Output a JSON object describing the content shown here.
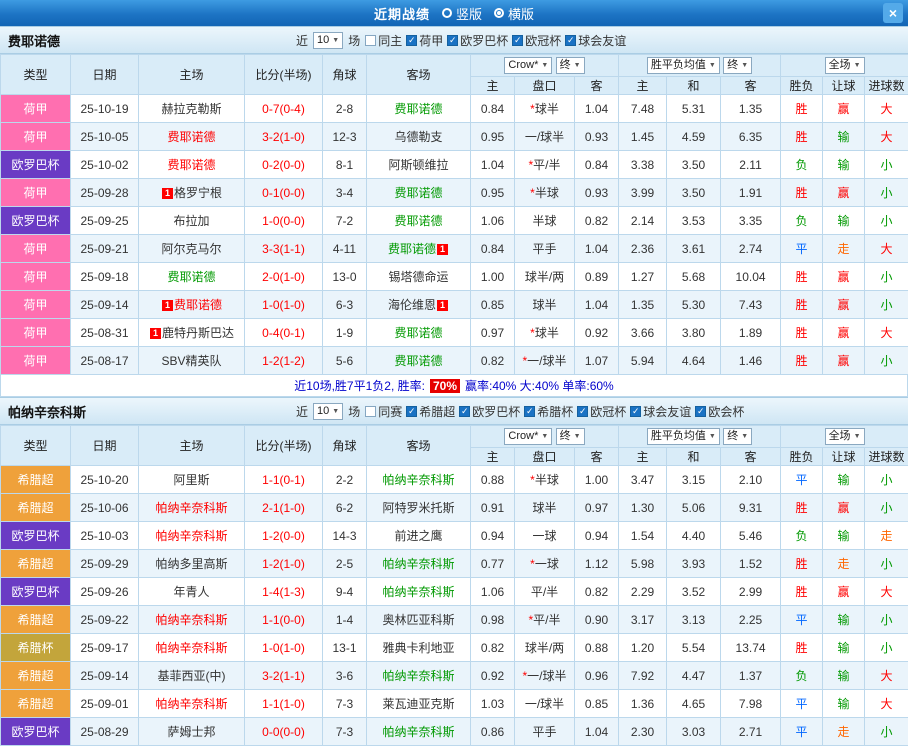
{
  "topbar": {
    "title": "近期战绩",
    "options": [
      {
        "key": "vertical",
        "label": "竖版",
        "selected": false
      },
      {
        "key": "horizontal",
        "label": "横版",
        "selected": true
      }
    ],
    "close_icon": "×"
  },
  "header": {
    "type": "类型",
    "date": "日期",
    "home": "主场",
    "score": "比分(半场)",
    "corner": "角球",
    "away": "客场",
    "company_select": "Crow*",
    "final_select": "终",
    "europe_select": "胜平负均值",
    "final_select2": "终",
    "scope_select": "全场",
    "asian_home": "主",
    "asian_handicap": "盘口",
    "asian_away": "客",
    "euro_home": "主",
    "euro_draw": "和",
    "euro_away": "客",
    "res_wdl": "胜负",
    "res_handicap": "让球",
    "res_goals": "进球数"
  },
  "league_colors": {
    "荷甲": "#ff6fb0",
    "欧罗巴杯": "#6a3bc4",
    "希腊超": "#efa13b",
    "希腊杯": "#c3a53b"
  },
  "result_colors": {
    "胜": "#ff0000",
    "平": "#0066ff",
    "负": "#009900",
    "赢": "#ff0000",
    "输": "#009900",
    "走": "#ff6600",
    "大": "#ff0000",
    "小": "#009900"
  },
  "team_colors": {
    "red": "#ff0000",
    "green": "#009900",
    "black": "#333333"
  },
  "sections": [
    {
      "team": "费耶诺德",
      "filter": {
        "near": "近",
        "count": "10",
        "unit": "场",
        "checkboxes": [
          {
            "label": "同主",
            "checked": false
          },
          {
            "label": "荷甲",
            "checked": true
          },
          {
            "label": "欧罗巴杯",
            "checked": true
          },
          {
            "label": "欧冠杯",
            "checked": true
          },
          {
            "label": "球会友谊",
            "checked": true
          }
        ]
      },
      "rows": [
        {
          "league": "荷甲",
          "date": "25-10-19",
          "home": {
            "name": "赫拉克勒斯",
            "color": "black"
          },
          "score": "0-7(0-4)",
          "corner": "2-8",
          "away": {
            "name": "费耶诺德",
            "color": "green"
          },
          "asian": [
            "0.84",
            "*球半",
            "1.04"
          ],
          "euro": [
            "7.48",
            "5.31",
            "1.35"
          ],
          "results": [
            "胜",
            "赢",
            "大"
          ]
        },
        {
          "league": "荷甲",
          "date": "25-10-05",
          "home": {
            "name": "费耶诺德",
            "color": "red"
          },
          "score": "3-2(1-0)",
          "corner": "12-3",
          "away": {
            "name": "乌德勒支",
            "color": "black"
          },
          "asian": [
            "0.95",
            "一/球半",
            "0.93"
          ],
          "euro": [
            "1.45",
            "4.59",
            "6.35"
          ],
          "results": [
            "胜",
            "输",
            "大"
          ]
        },
        {
          "league": "欧罗巴杯",
          "date": "25-10-02",
          "home": {
            "name": "费耶诺德",
            "color": "red"
          },
          "score": "0-2(0-0)",
          "corner": "8-1",
          "away": {
            "name": "阿斯顿维拉",
            "color": "black"
          },
          "asian": [
            "1.04",
            "*平/半",
            "0.84"
          ],
          "euro": [
            "3.38",
            "3.50",
            "2.11"
          ],
          "results": [
            "负",
            "输",
            "小"
          ]
        },
        {
          "league": "荷甲",
          "date": "25-09-28",
          "home": {
            "name": "格罗宁根",
            "color": "black",
            "badge_before": "1"
          },
          "score": "0-1(0-0)",
          "corner": "3-4",
          "away": {
            "name": "费耶诺德",
            "color": "green"
          },
          "asian": [
            "0.95",
            "*半球",
            "0.93"
          ],
          "euro": [
            "3.99",
            "3.50",
            "1.91"
          ],
          "results": [
            "胜",
            "赢",
            "小"
          ]
        },
        {
          "league": "欧罗巴杯",
          "date": "25-09-25",
          "home": {
            "name": "布拉加",
            "color": "black"
          },
          "score": "1-0(0-0)",
          "corner": "7-2",
          "away": {
            "name": "费耶诺德",
            "color": "green"
          },
          "asian": [
            "1.06",
            "半球",
            "0.82"
          ],
          "euro": [
            "2.14",
            "3.53",
            "3.35"
          ],
          "results": [
            "负",
            "输",
            "小"
          ]
        },
        {
          "league": "荷甲",
          "date": "25-09-21",
          "home": {
            "name": "阿尔克马尔",
            "color": "black"
          },
          "score": "3-3(1-1)",
          "corner": "4-11",
          "away": {
            "name": "费耶诺德",
            "color": "green",
            "badge_after": "1"
          },
          "asian": [
            "0.84",
            "平手",
            "1.04"
          ],
          "euro": [
            "2.36",
            "3.61",
            "2.74"
          ],
          "results": [
            "平",
            "走",
            "大"
          ]
        },
        {
          "league": "荷甲",
          "date": "25-09-18",
          "home": {
            "name": "费耶诺德",
            "color": "green"
          },
          "score": "2-0(1-0)",
          "corner": "13-0",
          "away": {
            "name": "锡塔德命运",
            "color": "black"
          },
          "asian": [
            "1.00",
            "球半/两",
            "0.89"
          ],
          "euro": [
            "1.27",
            "5.68",
            "10.04"
          ],
          "results": [
            "胜",
            "赢",
            "小"
          ]
        },
        {
          "league": "荷甲",
          "date": "25-09-14",
          "home": {
            "name": "费耶诺德",
            "color": "red",
            "badge_before": "1"
          },
          "score": "1-0(1-0)",
          "corner": "6-3",
          "away": {
            "name": "海伦维恩",
            "color": "black",
            "badge_after": "1"
          },
          "asian": [
            "0.85",
            "球半",
            "1.04"
          ],
          "euro": [
            "1.35",
            "5.30",
            "7.43"
          ],
          "results": [
            "胜",
            "赢",
            "小"
          ]
        },
        {
          "league": "荷甲",
          "date": "25-08-31",
          "home": {
            "name": "鹿特丹斯巴达",
            "color": "black",
            "badge_before": "1"
          },
          "score": "0-4(0-1)",
          "corner": "1-9",
          "away": {
            "name": "费耶诺德",
            "color": "green"
          },
          "asian": [
            "0.97",
            "*球半",
            "0.92"
          ],
          "euro": [
            "3.66",
            "3.80",
            "1.89"
          ],
          "results": [
            "胜",
            "赢",
            "大"
          ]
        },
        {
          "league": "荷甲",
          "date": "25-08-17",
          "home": {
            "name": "SBV精英队",
            "color": "black"
          },
          "score": "1-2(1-2)",
          "corner": "5-6",
          "away": {
            "name": "费耶诺德",
            "color": "green"
          },
          "asian": [
            "0.82",
            "*一/球半",
            "1.07"
          ],
          "euro": [
            "5.94",
            "4.64",
            "1.46"
          ],
          "results": [
            "胜",
            "赢",
            "小"
          ]
        }
      ],
      "summary": {
        "text": "近10场,胜7平1负2, 胜率:",
        "rate": "70%",
        "rest": "赢率:40%  大:40%  单率:60%"
      }
    },
    {
      "team": "帕纳辛奈科斯",
      "filter": {
        "near": "近",
        "count": "10",
        "unit": "场",
        "checkboxes": [
          {
            "label": "同赛",
            "checked": false
          },
          {
            "label": "希腊超",
            "checked": true
          },
          {
            "label": "欧罗巴杯",
            "checked": true
          },
          {
            "label": "希腊杯",
            "checked": true
          },
          {
            "label": "欧冠杯",
            "checked": true
          },
          {
            "label": "球会友谊",
            "checked": true
          },
          {
            "label": "欧会杯",
            "checked": true
          }
        ]
      },
      "rows": [
        {
          "league": "希腊超",
          "date": "25-10-20",
          "home": {
            "name": "阿里斯",
            "color": "black"
          },
          "score": "1-1(0-1)",
          "corner": "2-2",
          "away": {
            "name": "帕纳辛奈科斯",
            "color": "green"
          },
          "asian": [
            "0.88",
            "*半球",
            "1.00"
          ],
          "euro": [
            "3.47",
            "3.15",
            "2.10"
          ],
          "results": [
            "平",
            "输",
            "小"
          ]
        },
        {
          "league": "希腊超",
          "date": "25-10-06",
          "home": {
            "name": "帕纳辛奈科斯",
            "color": "red"
          },
          "score": "2-1(1-0)",
          "corner": "6-2",
          "away": {
            "name": "阿特罗米托斯",
            "color": "black"
          },
          "asian": [
            "0.91",
            "球半",
            "0.97"
          ],
          "euro": [
            "1.30",
            "5.06",
            "9.31"
          ],
          "results": [
            "胜",
            "赢",
            "小"
          ]
        },
        {
          "league": "欧罗巴杯",
          "date": "25-10-03",
          "home": {
            "name": "帕纳辛奈科斯",
            "color": "red"
          },
          "score": "1-2(0-0)",
          "corner": "14-3",
          "away": {
            "name": "前进之鹰",
            "color": "black"
          },
          "asian": [
            "0.94",
            "一球",
            "0.94"
          ],
          "euro": [
            "1.54",
            "4.40",
            "5.46"
          ],
          "results": [
            "负",
            "输",
            "走"
          ]
        },
        {
          "league": "希腊超",
          "date": "25-09-29",
          "home": {
            "name": "帕纳多里高斯",
            "color": "black"
          },
          "score": "1-2(1-0)",
          "corner": "2-5",
          "away": {
            "name": "帕纳辛奈科斯",
            "color": "green"
          },
          "asian": [
            "0.77",
            "*一球",
            "1.12"
          ],
          "euro": [
            "5.98",
            "3.93",
            "1.52"
          ],
          "results": [
            "胜",
            "走",
            "小"
          ]
        },
        {
          "league": "欧罗巴杯",
          "date": "25-09-26",
          "home": {
            "name": "年青人",
            "color": "black"
          },
          "score": "1-4(1-3)",
          "corner": "9-4",
          "away": {
            "name": "帕纳辛奈科斯",
            "color": "green"
          },
          "asian": [
            "1.06",
            "平/半",
            "0.82"
          ],
          "euro": [
            "2.29",
            "3.52",
            "2.99"
          ],
          "results": [
            "胜",
            "赢",
            "大"
          ]
        },
        {
          "league": "希腊超",
          "date": "25-09-22",
          "home": {
            "name": "帕纳辛奈科斯",
            "color": "red"
          },
          "score": "1-1(0-0)",
          "corner": "1-4",
          "away": {
            "name": "奥林匹亚科斯",
            "color": "black"
          },
          "asian": [
            "0.98",
            "*平/半",
            "0.90"
          ],
          "euro": [
            "3.17",
            "3.13",
            "2.25"
          ],
          "results": [
            "平",
            "输",
            "小"
          ]
        },
        {
          "league": "希腊杯",
          "date": "25-09-17",
          "home": {
            "name": "帕纳辛奈科斯",
            "color": "red"
          },
          "score": "1-0(1-0)",
          "corner": "13-1",
          "away": {
            "name": "雅典卡利地亚",
            "color": "black"
          },
          "asian": [
            "0.82",
            "球半/两",
            "0.88"
          ],
          "euro": [
            "1.20",
            "5.54",
            "13.74"
          ],
          "results": [
            "胜",
            "输",
            "小"
          ]
        },
        {
          "league": "希腊超",
          "date": "25-09-14",
          "home": {
            "name": "基菲西亚(中)",
            "color": "black"
          },
          "score": "3-2(1-1)",
          "corner": "3-6",
          "away": {
            "name": "帕纳辛奈科斯",
            "color": "green"
          },
          "asian": [
            "0.92",
            "*一/球半",
            "0.96"
          ],
          "euro": [
            "7.92",
            "4.47",
            "1.37"
          ],
          "results": [
            "负",
            "输",
            "大"
          ]
        },
        {
          "league": "希腊超",
          "date": "25-09-01",
          "home": {
            "name": "帕纳辛奈科斯",
            "color": "red"
          },
          "score": "1-1(1-0)",
          "corner": "7-3",
          "away": {
            "name": "莱瓦迪亚克斯",
            "color": "black"
          },
          "asian": [
            "1.03",
            "一/球半",
            "0.85"
          ],
          "euro": [
            "1.36",
            "4.65",
            "7.98"
          ],
          "results": [
            "平",
            "输",
            "大"
          ]
        },
        {
          "league": "欧罗巴杯",
          "date": "25-08-29",
          "home": {
            "name": "萨姆士邦",
            "color": "black"
          },
          "score": "0-0(0-0)",
          "corner": "7-3",
          "away": {
            "name": "帕纳辛奈科斯",
            "color": "green"
          },
          "asian": [
            "0.86",
            "平手",
            "1.04"
          ],
          "euro": [
            "2.30",
            "3.03",
            "2.71"
          ],
          "results": [
            "平",
            "走",
            "小"
          ]
        }
      ]
    }
  ]
}
